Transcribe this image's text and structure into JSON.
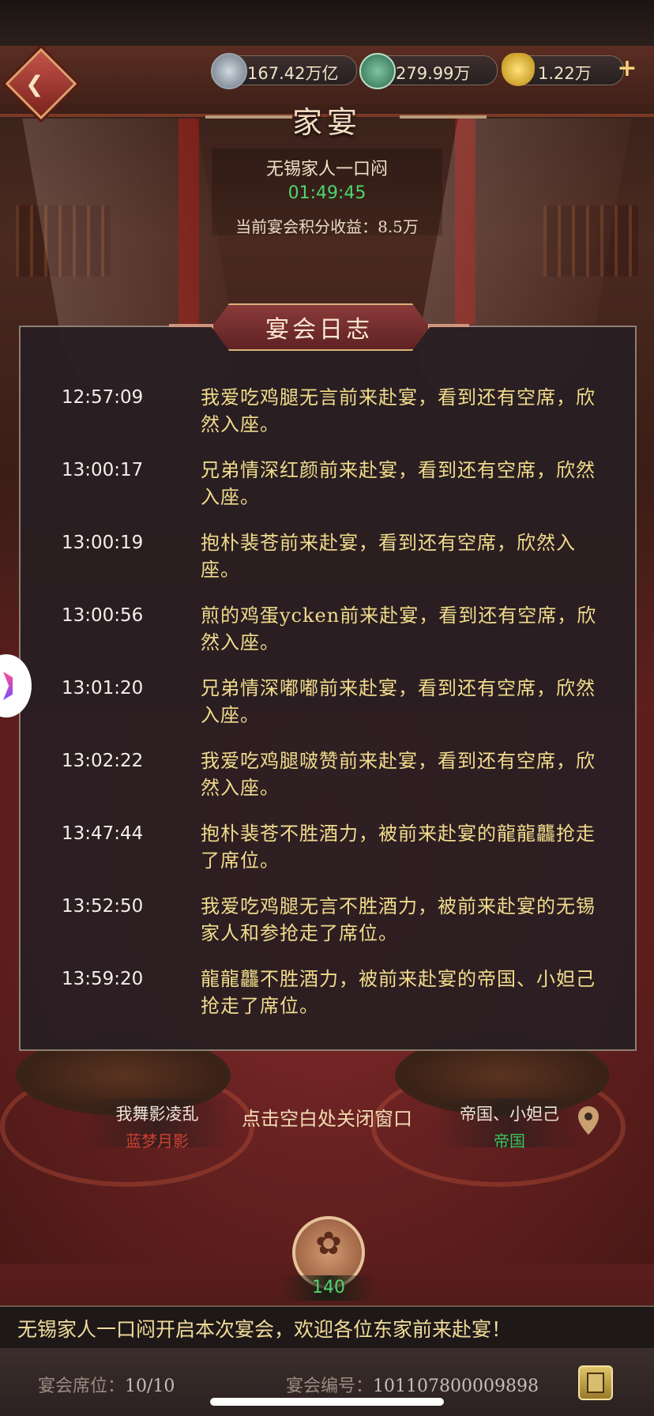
{
  "currencies": [
    {
      "icon": "silver-coin-icon",
      "value": "167.42万亿"
    },
    {
      "icon": "jade-token-icon",
      "value": "279.99万"
    },
    {
      "icon": "gold-ingot-icon",
      "value": "1.22万"
    }
  ],
  "banquet": {
    "title": "家宴",
    "host": "无锡家人一口闷",
    "timer": "01:49:45",
    "score_text": "当前宴会积分收益：8.5万"
  },
  "log": {
    "title": "宴会日志",
    "entries": [
      {
        "time": "12:57:09",
        "text": "我爱吃鸡腿无言前来赴宴，看到还有空席，欣然入座。"
      },
      {
        "time": "13:00:17",
        "text": "兄弟情深红颜前来赴宴，看到还有空席，欣然入座。"
      },
      {
        "time": "13:00:19",
        "text": "抱朴裴苍前来赴宴，看到还有空席，欣然入座。"
      },
      {
        "time": "13:00:56",
        "text": "煎的鸡蛋ycken前来赴宴，看到还有空席，欣然入座。"
      },
      {
        "time": "13:01:20",
        "text": "兄弟情深嘟嘟前来赴宴，看到还有空席，欣然入座。"
      },
      {
        "time": "13:02:22",
        "text": "我爱吃鸡腿啵赞前来赴宴，看到还有空席，欣然入座。"
      },
      {
        "time": "13:47:44",
        "text": "抱朴裴苍不胜酒力，被前来赴宴的龍龍龘抢走了席位。"
      },
      {
        "time": "13:52:50",
        "text": "我爱吃鸡腿无言不胜酒力，被前来赴宴的无锡家人和参抢走了席位。"
      },
      {
        "time": "13:59:20",
        "text": "龍龍龘不胜酒力，被前来赴宴的帝国、小妲己抢走了席位。"
      }
    ]
  },
  "close_hint": "点击空白处关闭窗口",
  "seat_left": {
    "name": "我舞影凌乱",
    "guild": "蓝梦月影"
  },
  "seat_right": {
    "name": "帝国、小妲己",
    "guild": "帝国"
  },
  "emblem_count": "140",
  "announcement": "无锡家人一口闷开启本次宴会，欢迎各位东家前来赴宴！",
  "footer": {
    "seats_label": "宴会席位：",
    "seats_value": "10/10",
    "id_label": "宴会编号：",
    "id_value": "101107800009898"
  },
  "colors": {
    "timer": "#4bd66c",
    "log_text": "#f1dc8c",
    "guild_red": "#d03e30",
    "guild_green": "#3bc25a"
  }
}
